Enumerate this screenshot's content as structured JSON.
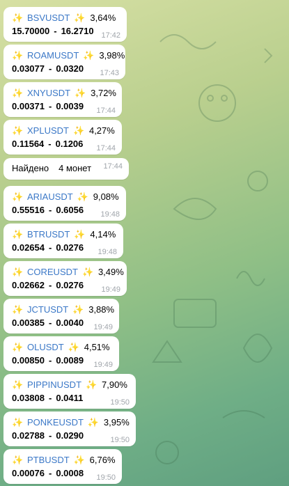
{
  "messages": [
    {
      "ticker": "BSVUSDT",
      "pct": "3,64%",
      "low": "15.70000",
      "high": "16.2710",
      "time": "17:42"
    },
    {
      "ticker": "ROAMUSDT",
      "pct": "3,98%",
      "low": "0.03077",
      "high": "0.0320",
      "time": "17:43"
    },
    {
      "ticker": "XNYUSDT",
      "pct": "3,72%",
      "low": "0.00371",
      "high": "0.0039",
      "time": "17:44"
    },
    {
      "ticker": "XPLUSDT",
      "pct": "4,27%",
      "low": "0.11564",
      "high": "0.1206",
      "time": "17:44"
    },
    {
      "ticker": "ARIAUSDT",
      "pct": "9,08%",
      "low": "0.55516",
      "high": "0.6056",
      "time": "19:48"
    },
    {
      "ticker": "BTRUSDT",
      "pct": "4,14%",
      "low": "0.02654",
      "high": "0.0276",
      "time": "19:48"
    },
    {
      "ticker": "COREUSDT",
      "pct": "3,49%",
      "low": "0.02662",
      "high": "0.0276",
      "time": "19:49"
    },
    {
      "ticker": "JCTUSDT",
      "pct": "3,88%",
      "low": "0.00385",
      "high": "0.0040",
      "time": "19:49"
    },
    {
      "ticker": "OLUSDT",
      "pct": "4,51%",
      "low": "0.00850",
      "high": "0.0089",
      "time": "19:49"
    },
    {
      "ticker": "PIPPINUSDT",
      "pct": "7,90%",
      "low": "0.03808",
      "high": "0.0411",
      "time": "19:50"
    },
    {
      "ticker": "PONKEUSDT",
      "pct": "3,95%",
      "low": "0.02788",
      "high": "0.0290",
      "time": "19:50"
    },
    {
      "ticker": "PTBUSDT",
      "pct": "6,76%",
      "low": "0.00076",
      "high": "0.0008",
      "time": "19:50"
    }
  ],
  "summary": {
    "found_label": "Найдено",
    "count_text": "4 монет",
    "time": "17:44"
  },
  "labels": {
    "dash": "-",
    "sparkle": "✨"
  },
  "colors": {
    "ticker": "#3b78c7",
    "sparkle": "#f0b70c",
    "time": "#a0a5ab",
    "bubble": "#ffffff"
  }
}
